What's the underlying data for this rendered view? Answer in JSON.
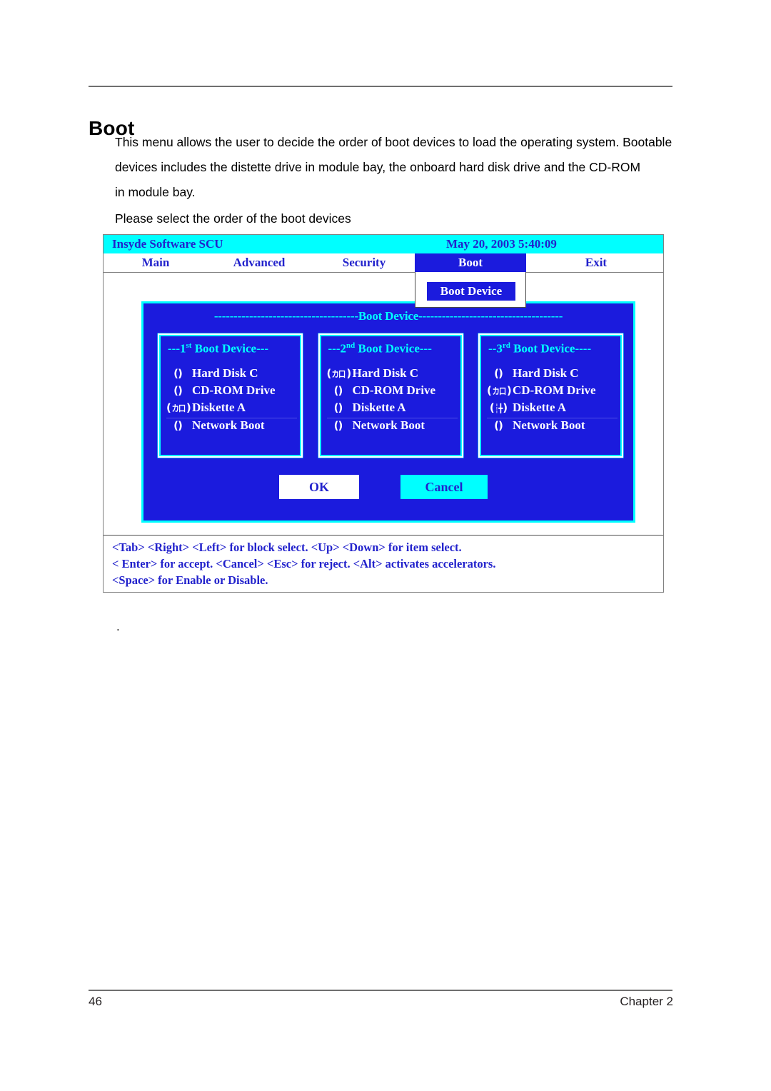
{
  "document": {
    "heading": "Boot",
    "paragraphs": [
      "This menu allows the user to decide the order of boot devices to load the operating system. Bootable",
      "devices includes the distette drive in module bay, the onboard hard disk drive and the CD-ROM",
      "in module bay.",
      "Please select the order of the boot devices"
    ],
    "stray_mark": ".",
    "footer": {
      "page_number": "46",
      "chapter": "Chapter 2"
    }
  },
  "bios": {
    "titlebar": {
      "app_name": "Insyde Software SCU",
      "datetime": "May 20, 2003 5:40:09"
    },
    "menu": [
      {
        "label": "Main",
        "selected": false
      },
      {
        "label": "Advanced",
        "selected": false
      },
      {
        "label": "Security",
        "selected": false
      },
      {
        "label": "Boot",
        "selected": true
      },
      {
        "label": "Exit",
        "selected": false
      }
    ],
    "dropdown": {
      "items": [
        {
          "label": "Boot Device",
          "highlighted": true
        }
      ]
    },
    "dialog": {
      "title": "-------------------------------------Boot Device-------------------------------------",
      "panels": [
        {
          "title_prefix": "---1",
          "title_ordinal": "st",
          "title_suffix": " Boot Device---",
          "options": [
            {
              "label": "Hard Disk C",
              "selected": false,
              "mark": ""
            },
            {
              "label": "CD-ROM Drive",
              "selected": false,
              "mark": ""
            },
            {
              "label": "Diskette A",
              "selected": true,
              "mark": "カ口"
            },
            {
              "label": "Network Boot",
              "selected": false,
              "mark": ""
            }
          ]
        },
        {
          "title_prefix": "---2",
          "title_ordinal": "nd",
          "title_suffix": " Boot Device---",
          "options": [
            {
              "label": "Hard Disk C",
              "selected": true,
              "mark": "カ口"
            },
            {
              "label": "CD-ROM Drive",
              "selected": false,
              "mark": ""
            },
            {
              "label": "Diskette A",
              "selected": false,
              "mark": ""
            },
            {
              "label": "Network Boot",
              "selected": false,
              "mark": ""
            }
          ]
        },
        {
          "title_prefix": "--3",
          "title_ordinal": "rd",
          "title_suffix": " Boot Device----",
          "options": [
            {
              "label": "Hard Disk C",
              "selected": false,
              "mark": ""
            },
            {
              "label": "CD-ROM Drive",
              "selected": true,
              "mark": "カ口"
            },
            {
              "label": "Diskette A",
              "selected": true,
              "mark": "┆╋"
            },
            {
              "label": "Network Boot",
              "selected": false,
              "mark": ""
            }
          ]
        }
      ],
      "buttons": {
        "ok": "OK",
        "cancel": "Cancel"
      }
    },
    "help": [
      "<Tab> <Right> <Left> for block select.    <Up> <Down> for item select.",
      "< Enter> for accept. <Cancel> <Esc> for reject. <Alt> activates accelerators.",
      "<Space> for Enable or Disable."
    ]
  },
  "colors": {
    "bios_blue": "#1b1bdd",
    "bios_cyan": "#00ffff",
    "text_blue": "#2222cc",
    "white": "#ffffff"
  }
}
